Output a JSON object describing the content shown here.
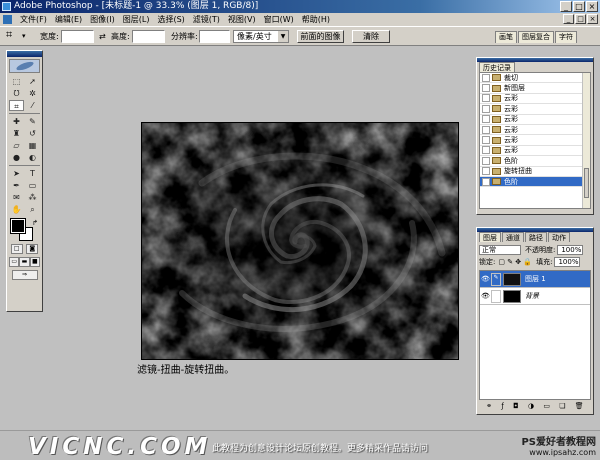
{
  "window": {
    "title": "Adobe Photoshop - [未标题-1 @ 33.3% (图层 1, RGB/8)]",
    "controls": [
      "_",
      "□",
      "×"
    ]
  },
  "menu": {
    "items": [
      "文件(F)",
      "编辑(E)",
      "图像(I)",
      "图层(L)",
      "选择(S)",
      "滤镜(T)",
      "视图(V)",
      "窗口(W)",
      "帮助(H)"
    ]
  },
  "options_bar": {
    "width_label": "宽度:",
    "height_label": "高度:",
    "swap_symbol": "⇄",
    "resolution_label": "分辨率:",
    "unit_select": "像素/英寸",
    "front_image_button": "前面的图像",
    "clear_button": "清除",
    "palette_tabs": [
      "画笔",
      "图层复合",
      "字符"
    ]
  },
  "history": {
    "tabs": [
      "历史记录"
    ],
    "items": [
      "裁切",
      "新图层",
      "云彩",
      "云彩",
      "云彩",
      "云彩",
      "云彩",
      "云彩",
      "色阶",
      "旋转扭曲",
      "色阶"
    ],
    "selected_index": 10
  },
  "layers": {
    "tabs": [
      "图层",
      "通道",
      "路径",
      "动作"
    ],
    "blend_mode": "正常",
    "opacity_label": "不透明度:",
    "opacity_value": "100%",
    "lock_label": "锁定:",
    "fill_label": "填充:",
    "fill_value": "100%",
    "rows": [
      {
        "name": "图层 1",
        "selected": true
      },
      {
        "name": "背景",
        "selected": false
      }
    ]
  },
  "caption": "滤镜-扭曲-旋转扭曲。",
  "footer": {
    "logo": "VICNC.COM",
    "notice": "此教程为创意设计论坛原创教程。更多精采作品请访问",
    "brand_line1": "PS爱好者教程网",
    "brand_line2": "www.ipsahz.com"
  }
}
